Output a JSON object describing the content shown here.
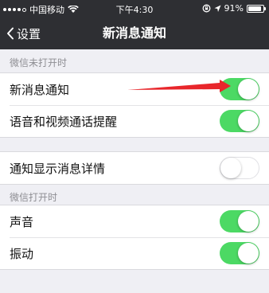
{
  "status_bar": {
    "carrier": "中国移动",
    "time": "下午4:30",
    "battery_percent": "91%",
    "battery_level": 0.91
  },
  "nav": {
    "back_label": "设置",
    "title": "新消息通知"
  },
  "sections": [
    {
      "header": "微信未打开时",
      "rows": [
        {
          "label": "新消息通知",
          "on": true
        },
        {
          "label": "语音和视频通话提醒",
          "on": true
        }
      ]
    },
    {
      "header": "",
      "rows": [
        {
          "label": "通知显示消息详情",
          "on": false
        }
      ]
    },
    {
      "header": "微信打开时",
      "rows": [
        {
          "label": "声音",
          "on": true
        },
        {
          "label": "振动",
          "on": true
        }
      ]
    }
  ],
  "colors": {
    "toggle_on": "#4cd964",
    "nav_bg": "#2e2f33",
    "annotation_arrow": "#e8262b"
  }
}
